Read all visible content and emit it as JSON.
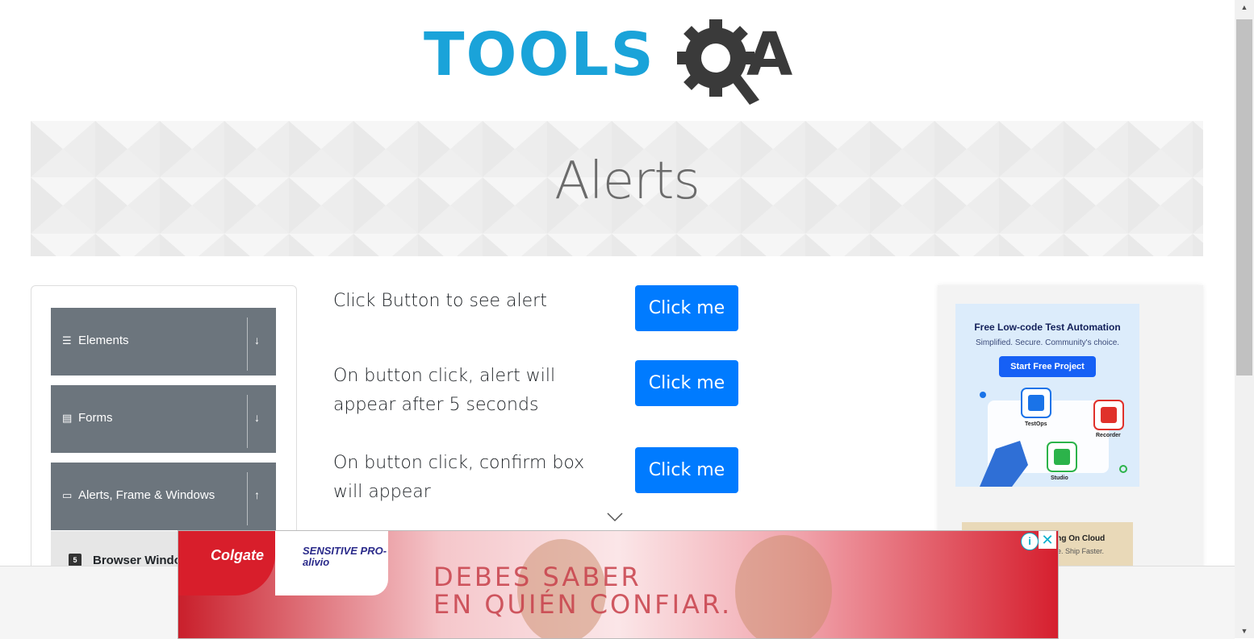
{
  "logo": {
    "text": "TOOLS",
    "suffix": "A"
  },
  "banner": {
    "title": "Alerts"
  },
  "sidebar": {
    "groups": [
      {
        "label": "Elements",
        "icon": "hamburger-icon",
        "arrow": "↓"
      },
      {
        "label": "Forms",
        "icon": "form-icon",
        "arrow": "↓"
      },
      {
        "label": "Alerts, Frame & Windows",
        "icon": "window-icon",
        "arrow": "↑"
      }
    ],
    "active_item": {
      "label": "Browser Windo",
      "icon": "html5-icon"
    }
  },
  "main": {
    "rows": [
      {
        "text": "Click Button to see alert",
        "button": "Click me"
      },
      {
        "text": "On button click, alert will appear after 5 seconds",
        "button": "Click me"
      },
      {
        "text": "On button click, confirm box will appear",
        "button": "Click me"
      }
    ]
  },
  "right_ad": {
    "title": "Free Low-code Test Automation",
    "subtitle": "Simplified. Secure. Community's choice.",
    "button": "Start Free Project",
    "labels": [
      "TestOps",
      "Recorder",
      "Studio"
    ],
    "card2_line1": "esting On Cloud",
    "card2_line2": "e. Ship Faster."
  },
  "bottom_ad": {
    "brand": "Colgate",
    "product": "SENSITIVE PRO-alivio",
    "line1": "DEBES SABER",
    "line2": "EN QUIÉN CONFIAR.",
    "info": "i",
    "close": "✕"
  },
  "colors": {
    "primary_button": "#007bff",
    "sidebar_group": "#6c757d",
    "logo_blue": "#1aa3d9"
  }
}
